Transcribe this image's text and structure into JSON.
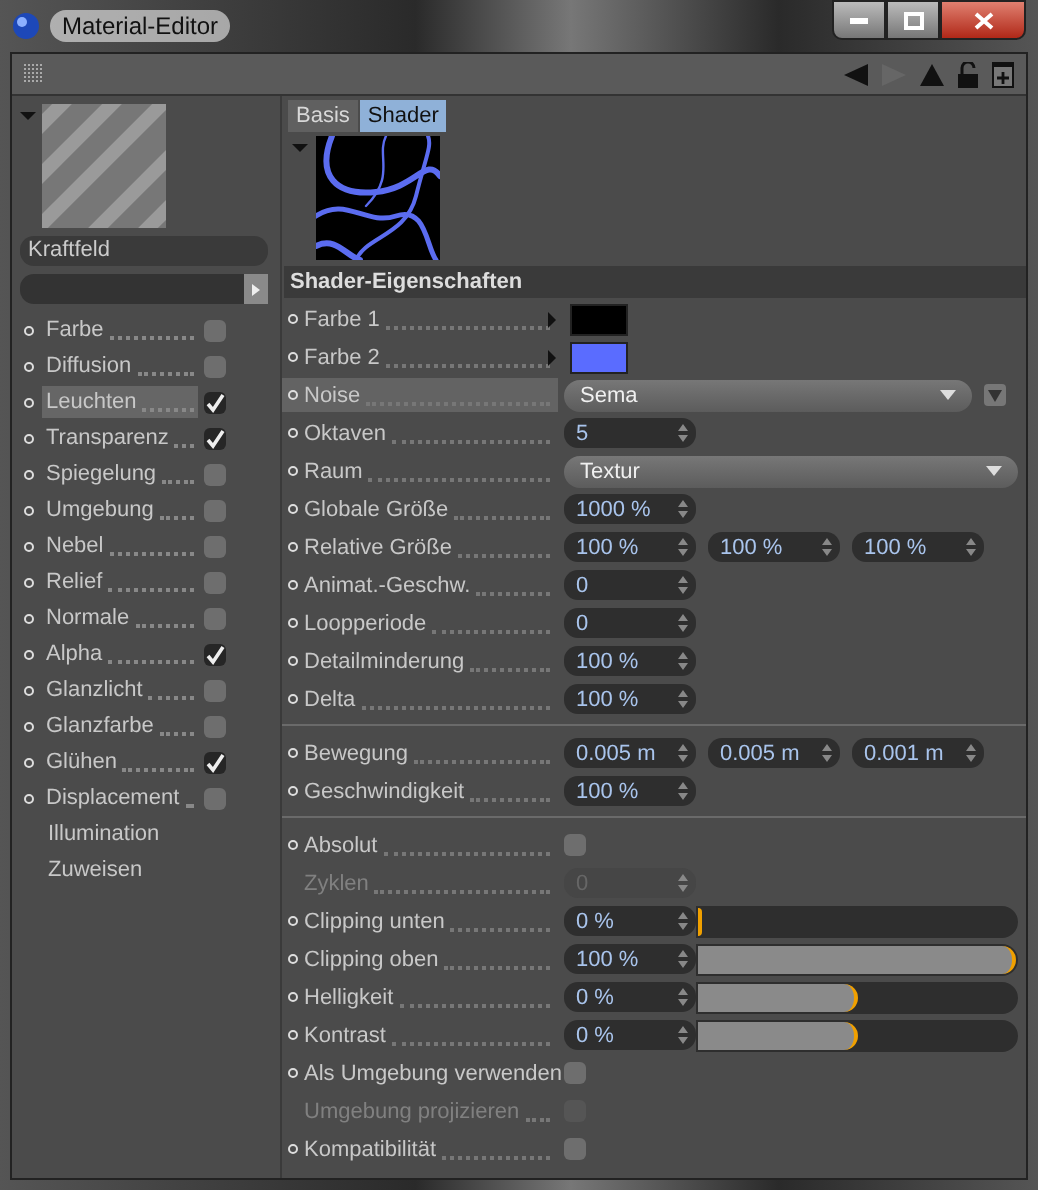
{
  "window": {
    "title": "Material-Editor"
  },
  "material": {
    "name": "Kraftfeld"
  },
  "channels": [
    {
      "label": "Farbe",
      "kind": "channel",
      "checked": false,
      "selected": false
    },
    {
      "label": "Diffusion",
      "kind": "channel",
      "checked": false,
      "selected": false
    },
    {
      "label": "Leuchten",
      "kind": "channel",
      "checked": true,
      "selected": true
    },
    {
      "label": "Transparenz",
      "kind": "channel",
      "checked": true,
      "selected": false
    },
    {
      "label": "Spiegelung",
      "kind": "channel",
      "checked": false,
      "selected": false
    },
    {
      "label": "Umgebung",
      "kind": "channel",
      "checked": false,
      "selected": false
    },
    {
      "label": "Nebel",
      "kind": "channel",
      "checked": false,
      "selected": false
    },
    {
      "label": "Relief",
      "kind": "channel",
      "checked": false,
      "selected": false
    },
    {
      "label": "Normale",
      "kind": "channel",
      "checked": false,
      "selected": false
    },
    {
      "label": "Alpha",
      "kind": "channel",
      "checked": true,
      "selected": false
    },
    {
      "label": "Glanzlicht",
      "kind": "channel",
      "checked": false,
      "selected": false
    },
    {
      "label": "Glanzfarbe",
      "kind": "channel",
      "checked": false,
      "selected": false
    },
    {
      "label": "Glühen",
      "kind": "channel",
      "checked": true,
      "selected": false
    },
    {
      "label": "Displacement",
      "kind": "channel",
      "checked": false,
      "selected": false
    },
    {
      "label": "Illumination",
      "kind": "link",
      "selected": false
    },
    {
      "label": "Zuweisen",
      "kind": "link",
      "selected": false
    }
  ],
  "tabs": [
    {
      "label": "Basis",
      "selected": false
    },
    {
      "label": "Shader",
      "selected": true
    }
  ],
  "section": {
    "title": "Shader-Eigenschaften"
  },
  "groups": [
    [
      {
        "kind": "color",
        "label": "Farbe 1",
        "color": "#000000",
        "selected": false,
        "disabled": false
      },
      {
        "kind": "color",
        "label": "Farbe 2",
        "color": "#5a6cff",
        "selected": false,
        "disabled": false
      },
      {
        "kind": "preset",
        "label": "Noise",
        "value": "Sema",
        "selected": true,
        "disabled": false
      },
      {
        "kind": "number",
        "label": "Oktaven",
        "values": [
          "5"
        ],
        "selected": false,
        "disabled": false
      },
      {
        "kind": "dropdown",
        "label": "Raum",
        "value": "Textur",
        "selected": false,
        "disabled": false
      },
      {
        "kind": "number",
        "label": "Globale Größe",
        "values": [
          "1000 %"
        ],
        "selected": false,
        "disabled": false
      },
      {
        "kind": "number",
        "label": "Relative Größe",
        "values": [
          "100 %",
          "100 %",
          "100 %"
        ],
        "selected": false,
        "disabled": false
      },
      {
        "kind": "number",
        "label": "Animat.-Geschw.",
        "values": [
          "0"
        ],
        "selected": false,
        "disabled": false
      },
      {
        "kind": "number",
        "label": "Loopperiode",
        "values": [
          "0"
        ],
        "selected": false,
        "disabled": false
      },
      {
        "kind": "number",
        "label": "Detailminderung",
        "values": [
          "100 %"
        ],
        "selected": false,
        "disabled": false
      },
      {
        "kind": "number",
        "label": "Delta",
        "values": [
          "100 %"
        ],
        "selected": false,
        "disabled": false
      }
    ],
    [
      {
        "kind": "number",
        "label": "Bewegung",
        "values": [
          "0.005 m",
          "0.005 m",
          "0.001 m"
        ],
        "selected": false,
        "disabled": false
      },
      {
        "kind": "number",
        "label": "Geschwindigkeit",
        "values": [
          "100 %"
        ],
        "selected": false,
        "disabled": false
      }
    ],
    [
      {
        "kind": "checkbox",
        "label": "Absolut",
        "checked": false,
        "selected": false,
        "disabled": false
      },
      {
        "kind": "number",
        "label": "Zyklen",
        "values": [
          "0"
        ],
        "selected": false,
        "disabled": true
      },
      {
        "kind": "slider",
        "label": "Clipping unten",
        "values": [
          "0 %"
        ],
        "level": 0,
        "selected": false,
        "disabled": false
      },
      {
        "kind": "slider",
        "label": "Clipping oben",
        "values": [
          "100 %"
        ],
        "level": 1,
        "selected": false,
        "disabled": false
      },
      {
        "kind": "slider",
        "label": "Helligkeit",
        "values": [
          "0 %"
        ],
        "level": 0.5,
        "selected": false,
        "disabled": false
      },
      {
        "kind": "slider",
        "label": "Kontrast",
        "values": [
          "0 %"
        ],
        "level": 0.5,
        "selected": false,
        "disabled": false
      },
      {
        "kind": "checkbox",
        "label": "Als Umgebung verwenden",
        "checked": false,
        "selected": false,
        "disabled": false
      },
      {
        "kind": "checkbox",
        "label": "Umgebung projizieren",
        "checked": false,
        "selected": false,
        "disabled": true
      },
      {
        "kind": "checkbox",
        "label": "Kompatibilität",
        "checked": false,
        "selected": false,
        "disabled": false
      }
    ]
  ]
}
